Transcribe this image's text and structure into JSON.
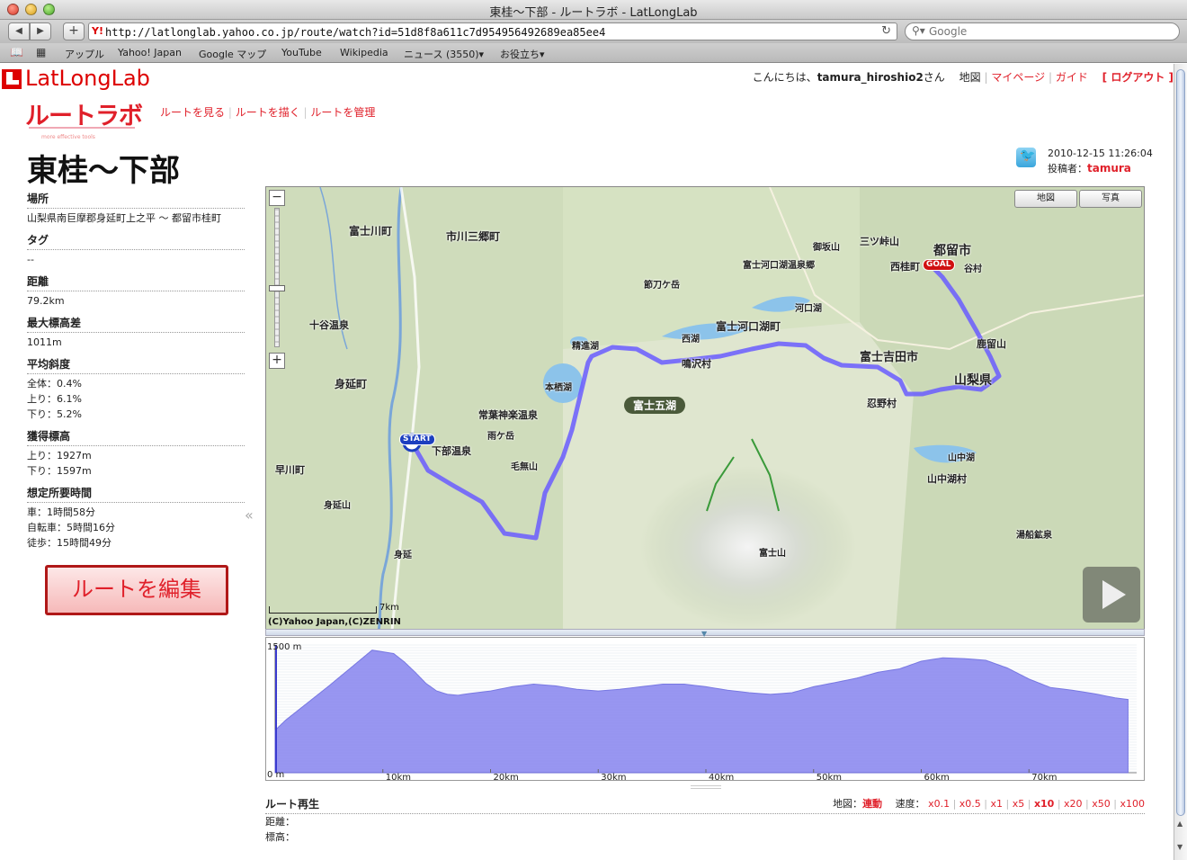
{
  "window": {
    "title": "東桂〜下部 - ルートラボ - LatLongLab"
  },
  "browser": {
    "url": "http://latlonglab.yahoo.co.jp/route/watch?id=51d8f8a611c7d954956492689ea85ee4",
    "search_placeholder": "Google",
    "bookmarks": [
      "アップル",
      "Yahoo! Japan",
      "Google マップ",
      "YouTube",
      "Wikipedia",
      "ニュース (3550)▾",
      "お役立ち▾"
    ]
  },
  "header": {
    "logo_text": "LatLongLab",
    "sublogo_text": "ルートラボ",
    "sublogo_tagline": "more effective tools",
    "nav": [
      "ルートを見る",
      "ルートを描く",
      "ルートを管理"
    ],
    "greeting_prefix": "こんにちは、",
    "username": "tamura_hiroshio2",
    "greeting_suffix": "さん",
    "links": [
      "地図",
      "マイページ",
      "ガイド"
    ],
    "logout": "[ ログアウト ]"
  },
  "route": {
    "title": "東桂〜下部",
    "datetime": "2010-12-15 11:26:04",
    "author_label": "投稿者：",
    "author": "tamura"
  },
  "info": {
    "place_label": "場所",
    "place": "山梨県南巨摩郡身延町上之平 〜 都留市桂町",
    "tag_label": "タグ",
    "tag": "--",
    "distance_label": "距離",
    "distance": "79.2km",
    "max_elev_label": "最大標高差",
    "max_elev": "1011m",
    "slope_label": "平均斜度",
    "slope_all": "全体：0.4%",
    "slope_up": "上り：6.1%",
    "slope_down": "下り：5.2%",
    "gain_label": "獲得標高",
    "gain_up": "上り：1927m",
    "gain_down": "下り：1597m",
    "time_label": "想定所要時間",
    "time_car": "車：1時間58分",
    "time_bike": "自転車：5時間16分",
    "time_walk": "徒歩：15時間49分"
  },
  "edit_button": "ルートを編集",
  "map": {
    "btn_map": "地図",
    "btn_photo": "写真",
    "start": "START",
    "goal": "GOAL",
    "area_label": "富士五湖",
    "scale": "7km",
    "copyright": "(C)Yahoo Japan,(C)ZENRIN",
    "places": [
      {
        "name": "都留市"
      },
      {
        "name": "富士吉田市"
      },
      {
        "name": "富士河口湖町"
      },
      {
        "name": "鳴沢村"
      },
      {
        "name": "忍野村"
      },
      {
        "name": "山中湖村"
      },
      {
        "name": "山梨県"
      },
      {
        "name": "身延町"
      },
      {
        "name": "富士山"
      },
      {
        "name": "本栖湖"
      },
      {
        "name": "精進湖"
      },
      {
        "name": "西湖"
      },
      {
        "name": "河口湖"
      },
      {
        "name": "山中湖"
      },
      {
        "name": "富士川町"
      },
      {
        "name": "市川三郷町"
      },
      {
        "name": "早川町"
      },
      {
        "name": "十谷温泉"
      },
      {
        "name": "常葉神楽温泉"
      },
      {
        "name": "雨ケ岳"
      },
      {
        "name": "毛無山"
      },
      {
        "name": "身延山"
      },
      {
        "name": "身延"
      },
      {
        "name": "下部温泉"
      },
      {
        "name": "西桂町"
      },
      {
        "name": "御坂山"
      },
      {
        "name": "三ツ峠山"
      },
      {
        "name": "節刀ケ岳"
      },
      {
        "name": "富士河口湖温泉郷"
      },
      {
        "name": "鹿留山"
      },
      {
        "name": "湯船鉱泉"
      },
      {
        "name": "谷村"
      }
    ]
  },
  "elevation": {
    "y_label": "1500 m",
    "y0_label": "0 m",
    "x_ticks": [
      "10km",
      "20km",
      "30km",
      "40km",
      "50km",
      "60km",
      "70km"
    ],
    "profile": {
      "type": "area",
      "x_km": [
        0,
        1,
        3,
        5,
        7,
        9,
        11,
        12,
        13,
        14,
        15,
        16,
        17,
        18,
        20,
        22,
        24,
        26,
        28,
        30,
        32,
        34,
        36,
        38,
        40,
        42,
        44,
        46,
        48,
        50,
        52,
        54,
        56,
        58,
        60,
        62,
        64,
        66,
        68,
        70,
        72,
        74,
        76,
        78,
        79.2
      ],
      "y_m": [
        500,
        620,
        820,
        1020,
        1230,
        1440,
        1400,
        1300,
        1180,
        1050,
        960,
        920,
        910,
        930,
        960,
        1010,
        1040,
        1020,
        980,
        960,
        980,
        1010,
        1040,
        1040,
        1010,
        970,
        940,
        920,
        940,
        1010,
        1060,
        1110,
        1180,
        1220,
        1310,
        1350,
        1340,
        1320,
        1230,
        1100,
        1000,
        970,
        930,
        880,
        860
      ]
    }
  },
  "replay": {
    "title": "ルート再生",
    "distance_label": "距離：",
    "height_label": "標高：",
    "map_label": "地図：",
    "map_mode": "連動",
    "speed_label": "速度：",
    "speeds": [
      "x0.1",
      "x0.5",
      "x1",
      "x5",
      "x10",
      "x20",
      "x50",
      "x100"
    ],
    "active_speed": "x10"
  },
  "colors": {
    "accent": "#e0202a",
    "route": "#6a5cff",
    "profile_fill": "#8d8bf0"
  }
}
